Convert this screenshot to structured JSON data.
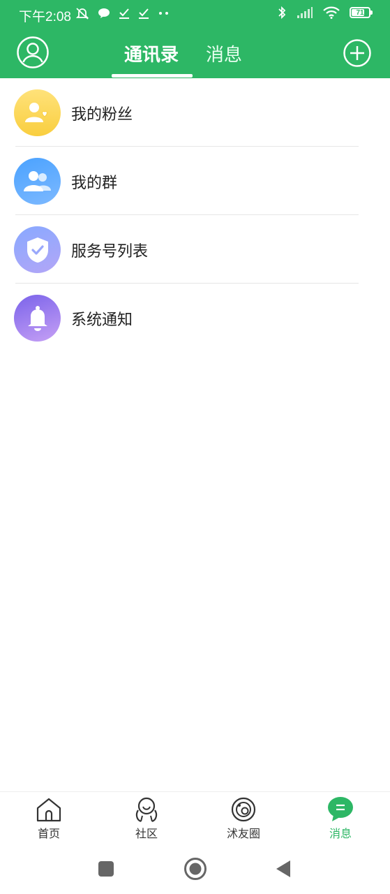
{
  "status_bar": {
    "time": "下午2:08",
    "battery": "71"
  },
  "header": {
    "tabs": [
      {
        "label": "通讯录",
        "active": true
      },
      {
        "label": "消息",
        "active": false
      }
    ]
  },
  "contacts_list": [
    {
      "label": "我的粉丝",
      "icon": "fans-icon"
    },
    {
      "label": "我的群",
      "icon": "group-icon"
    },
    {
      "label": "服务号列表",
      "icon": "shield-icon"
    },
    {
      "label": "系统通知",
      "icon": "bell-icon"
    }
  ],
  "bottom_nav": [
    {
      "label": "首页",
      "icon": "home-icon",
      "active": false
    },
    {
      "label": "社区",
      "icon": "community-icon",
      "active": false
    },
    {
      "label": "沭友圈",
      "icon": "moments-icon",
      "active": false
    },
    {
      "label": "消息",
      "icon": "chat-bubble-icon",
      "active": true
    }
  ],
  "colors": {
    "brand_green": "#2db765",
    "fans_yellow": "#f9ce3f",
    "group_blue": "#4aa2ff",
    "service_lavender": "#9aa8fb",
    "notice_purple": "#8a6cef"
  }
}
